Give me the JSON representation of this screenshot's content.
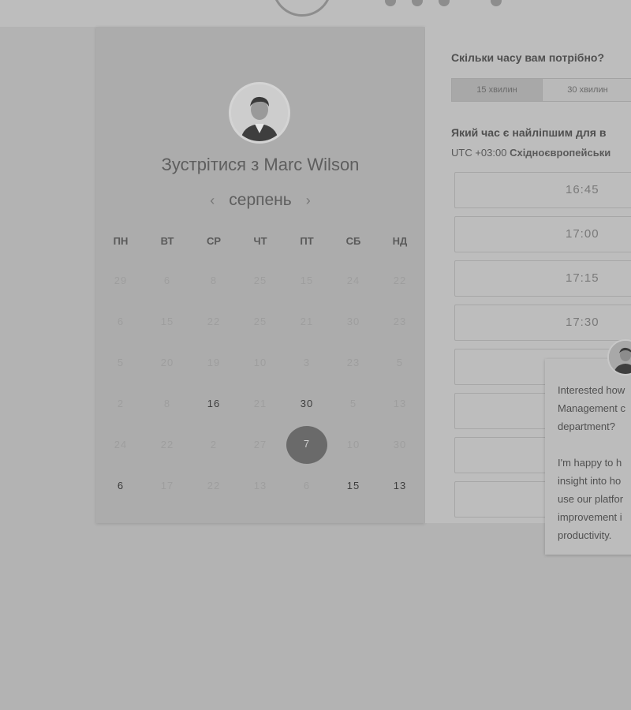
{
  "booking": {
    "title": "Зустрітися з Marc Wilson",
    "month": "серпень",
    "prev_icon": "‹",
    "next_icon": "›",
    "weekdays": [
      "ПН",
      "ВТ",
      "СР",
      "ЧТ",
      "ПТ",
      "СБ",
      "НД"
    ],
    "weeks": [
      [
        {
          "d": "29",
          "a": false
        },
        {
          "d": "6",
          "a": false
        },
        {
          "d": "8",
          "a": false
        },
        {
          "d": "25",
          "a": false
        },
        {
          "d": "15",
          "a": false
        },
        {
          "d": "24",
          "a": false
        },
        {
          "d": "22",
          "a": false
        }
      ],
      [
        {
          "d": "6",
          "a": false
        },
        {
          "d": "15",
          "a": false
        },
        {
          "d": "22",
          "a": false
        },
        {
          "d": "25",
          "a": false
        },
        {
          "d": "21",
          "a": false
        },
        {
          "d": "30",
          "a": false
        },
        {
          "d": "23",
          "a": false
        }
      ],
      [
        {
          "d": "5",
          "a": false
        },
        {
          "d": "20",
          "a": false
        },
        {
          "d": "19",
          "a": false
        },
        {
          "d": "10",
          "a": false
        },
        {
          "d": "3",
          "a": false
        },
        {
          "d": "23",
          "a": false
        },
        {
          "d": "5",
          "a": false
        }
      ],
      [
        {
          "d": "2",
          "a": false
        },
        {
          "d": "8",
          "a": false
        },
        {
          "d": "16",
          "a": true
        },
        {
          "d": "21",
          "a": false
        },
        {
          "d": "30",
          "a": true
        },
        {
          "d": "5",
          "a": false
        },
        {
          "d": "13",
          "a": false
        }
      ],
      [
        {
          "d": "24",
          "a": false
        },
        {
          "d": "22",
          "a": false
        },
        {
          "d": "2",
          "a": false
        },
        {
          "d": "27",
          "a": false
        },
        {
          "d": "7",
          "a": true,
          "s": true
        },
        {
          "d": "10",
          "a": false
        },
        {
          "d": "30",
          "a": false
        }
      ],
      [
        {
          "d": "6",
          "a": true
        },
        {
          "d": "17",
          "a": false
        },
        {
          "d": "22",
          "a": false
        },
        {
          "d": "13",
          "a": false
        },
        {
          "d": "6",
          "a": false
        },
        {
          "d": "15",
          "a": true
        },
        {
          "d": "13",
          "a": true
        }
      ]
    ]
  },
  "duration": {
    "question": "Скільки часу вам потрібно?",
    "options": [
      "15 хвилин",
      "30 хвилин"
    ],
    "selected_index": 0
  },
  "time": {
    "question": "Який час є найліпшим для в",
    "tz_offset": "UTC +03:00",
    "tz_name": "Східноєвропейськи",
    "slots": [
      "16:45",
      "17:00",
      "17:15",
      "17:30",
      "",
      "",
      "",
      ""
    ]
  },
  "chat": {
    "message": "Interested how\nManagement c\ndepartment?\n\nI'm happy to h\ninsight into ho\nuse our platfor\nimprovement i\nproductivity."
  },
  "colors": {
    "selected_day": "#6a6a6a",
    "page_overlay": "#b3b3b3"
  }
}
